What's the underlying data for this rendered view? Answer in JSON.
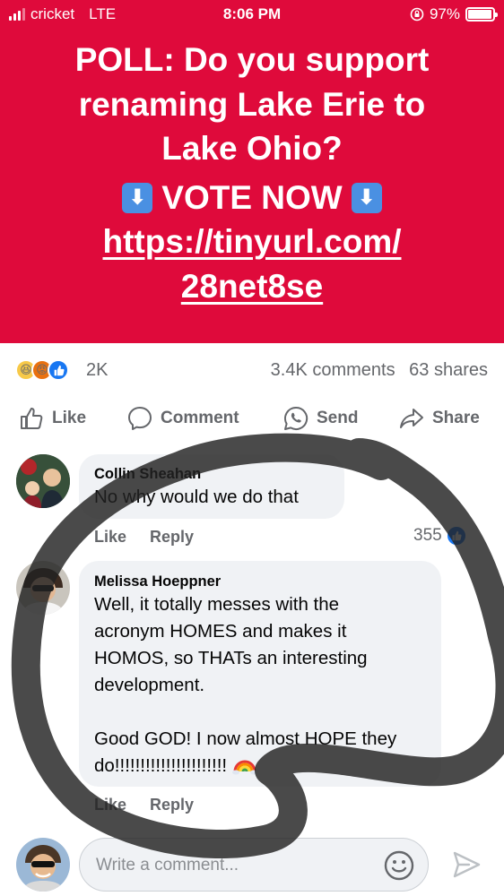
{
  "status_bar": {
    "carrier": "cricket",
    "network": "LTE",
    "time": "8:06 PM",
    "battery": "97%",
    "battery_level": 0.97
  },
  "post": {
    "line1": "POLL: Do you support",
    "line2": "renaming Lake Erie to",
    "line3": "Lake Ohio?",
    "vote_text": "VOTE NOW",
    "vote_icon": "down-arrow-emoji",
    "link_line1": "https://tinyurl.com/",
    "link_line2": "28net8se",
    "background_color": "#df0a3b"
  },
  "stats": {
    "reaction_count": "2K",
    "comments": "3.4K comments",
    "shares": "63 shares",
    "reaction_icons": [
      "haha",
      "angry",
      "like"
    ]
  },
  "actions": {
    "like": "Like",
    "comment": "Comment",
    "send": "Send",
    "share": "Share"
  },
  "comments": [
    {
      "author": "Collin Sheahan",
      "text": "No why would we do that",
      "like_label": "Like",
      "reply_label": "Reply",
      "like_count": "355"
    },
    {
      "author": "Melissa Hoeppner",
      "text": "Well, it totally messes with the\nacronym HOMES and makes it\nHOMOS, so THATs an interesting\ndevelopment.\n\nGood GOD! I now almost HOPE they\ndo!!!!!!!!!!!!!!!!!!!!!!",
      "emoji": "rainbow-emoji",
      "like_label": "Like",
      "reply_label": "Reply"
    }
  ],
  "composer": {
    "placeholder": "Write a comment..."
  }
}
